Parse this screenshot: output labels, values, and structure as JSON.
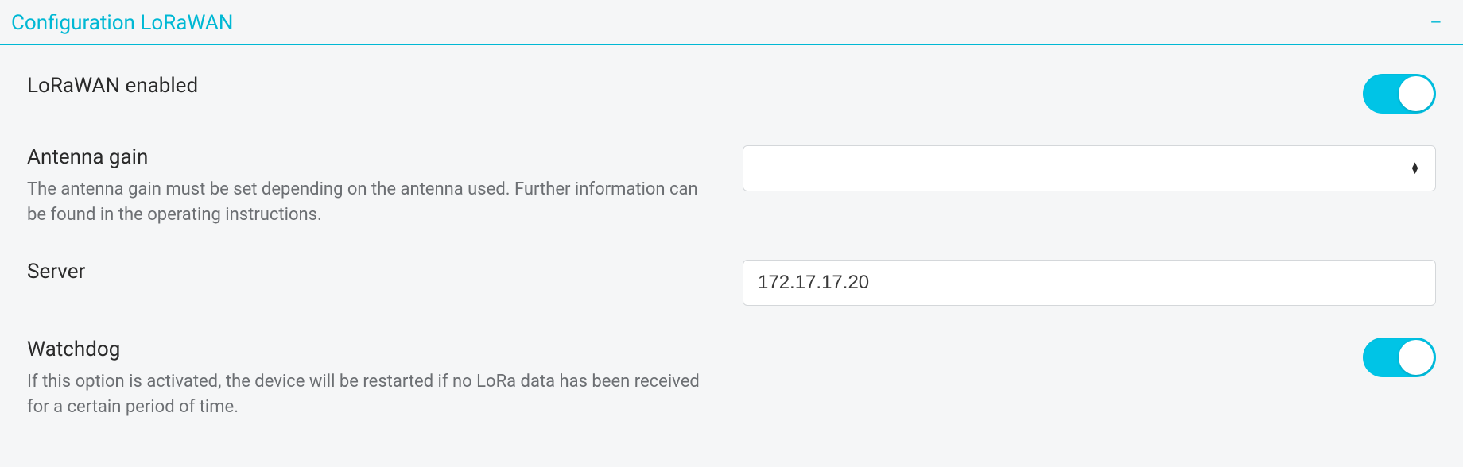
{
  "panel": {
    "title": "Configuration LoRaWAN"
  },
  "fields": {
    "lorawan": {
      "label": "LoRaWAN enabled",
      "enabled": true
    },
    "antenna": {
      "label": "Antenna gain",
      "help": "The antenna gain must be set depending on the antenna used. Further information can be found in the operating instructions.",
      "value": ""
    },
    "server": {
      "label": "Server",
      "value": "172.17.17.20"
    },
    "watchdog": {
      "label": "Watchdog",
      "help": "If this option is activated, the device will be restarted if no LoRa data has been received for a certain period of time.",
      "enabled": true
    }
  }
}
